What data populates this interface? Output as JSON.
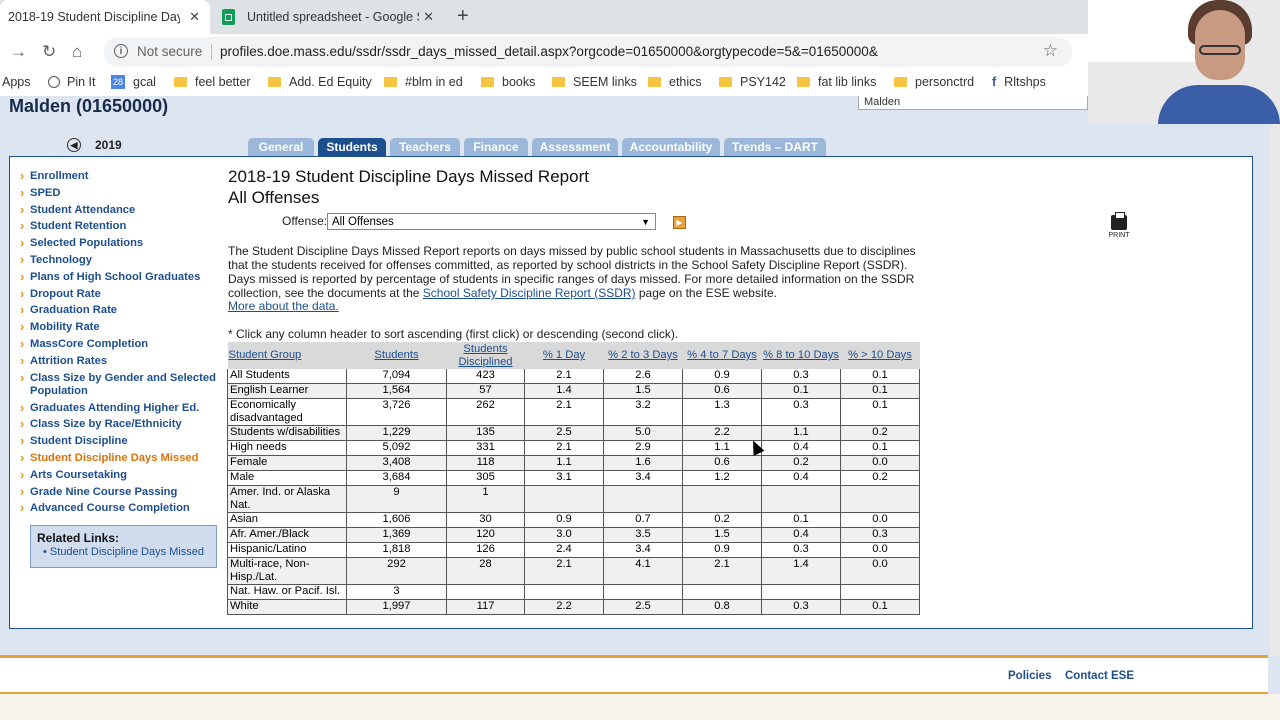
{
  "browser": {
    "tabs": [
      {
        "label": "2018-19 Student Discipline Days"
      },
      {
        "label": "Untitled spreadsheet - Google Sh"
      }
    ],
    "security": "Not secure",
    "url": "profiles.doe.mass.edu/ssdr/ssdr_days_missed_detail.aspx?orgcode=01650000&orgtypecode=5&=01650000&",
    "bookmarks": [
      "Apps",
      "Pin It",
      "gcal",
      "feel better",
      "Add. Ed Equity",
      "#blm in ed",
      "books",
      "SEEM links",
      "ethics",
      "PSY142",
      "fat lib links",
      "personctrd",
      "Rltshps"
    ],
    "gcal_icon": "28"
  },
  "page": {
    "org_name": "Malden (01650000)",
    "org_select": "Malden",
    "year": "2019",
    "tabs": [
      "General",
      "Students",
      "Teachers",
      "Finance",
      "Assessment",
      "Accountability",
      "Trends – DART"
    ],
    "sidenav": [
      "Enrollment",
      "SPED",
      "Student Attendance",
      "Student Retention",
      "Selected Populations",
      "Technology",
      "Plans of High School Graduates",
      "Dropout Rate",
      "Graduation Rate",
      "Mobility Rate",
      "MassCore Completion",
      "Attrition Rates",
      "Class Size by Gender and Selected Population",
      "Graduates Attending Higher Ed.",
      "Class Size by Race/Ethnicity",
      "Student Discipline",
      "Student Discipline Days Missed",
      "Arts Coursetaking",
      "Grade Nine Course Passing",
      "Advanced Course Completion"
    ],
    "related_heading": "Related Links:",
    "related_link": "Student Discipline Days Missed",
    "title_line1": "2018-19 Student Discipline Days Missed Report",
    "title_line2": "All Offenses",
    "offense_label": "Offense:",
    "offense_value": "All Offenses",
    "desc_part1": "The Student Discipline Days Missed Report reports on days missed by public school students in Massachusetts due to disciplines that the students received for offenses committed, as reported by school districts in the School Safety Discipline Report (SSDR). Days missed is reported by percentage of students in specific ranges of days missed. For more detailed information on the SSDR collection, see the documents at the ",
    "desc_link": "School Safety Discipline Report (SSDR)",
    "desc_part2": " page on the ESE website.",
    "more_link": "More about the data.",
    "sort_note": "* Click any column header to sort ascending (first click) or descending (second click).",
    "print_label": "PRINT",
    "footer_policies": "Policies",
    "footer_contact": "Contact ESE"
  },
  "table": {
    "headers": [
      "Student Group",
      "Students",
      "Students Disciplined",
      "% 1 Day",
      "% 2 to 3 Days",
      "% 4 to 7 Days",
      "% 8 to 10 Days",
      "% > 10 Days"
    ],
    "rows": [
      [
        "All Students",
        "7,094",
        "423",
        "2.1",
        "2.6",
        "0.9",
        "0.3",
        "0.1"
      ],
      [
        "English Learner",
        "1,564",
        "57",
        "1.4",
        "1.5",
        "0.6",
        "0.1",
        "0.1"
      ],
      [
        "Economically disadvantaged",
        "3,726",
        "262",
        "2.1",
        "3.2",
        "1.3",
        "0.3",
        "0.1"
      ],
      [
        "Students w/disabilities",
        "1,229",
        "135",
        "2.5",
        "5.0",
        "2.2",
        "1.1",
        "0.2"
      ],
      [
        "High needs",
        "5,092",
        "331",
        "2.1",
        "2.9",
        "1.1",
        "0.4",
        "0.1"
      ],
      [
        "Female",
        "3,408",
        "118",
        "1.1",
        "1.6",
        "0.6",
        "0.2",
        "0.0"
      ],
      [
        "Male",
        "3,684",
        "305",
        "3.1",
        "3.4",
        "1.2",
        "0.4",
        "0.2"
      ],
      [
        "Amer. Ind. or Alaska Nat.",
        "9",
        "1",
        "",
        "",
        "",
        "",
        ""
      ],
      [
        "Asian",
        "1,606",
        "30",
        "0.9",
        "0.7",
        "0.2",
        "0.1",
        "0.0"
      ],
      [
        "Afr. Amer./Black",
        "1,369",
        "120",
        "3.0",
        "3.5",
        "1.5",
        "0.4",
        "0.3"
      ],
      [
        "Hispanic/Latino",
        "1,818",
        "126",
        "2.4",
        "3.4",
        "0.9",
        "0.3",
        "0.0"
      ],
      [
        "Multi-race, Non-Hisp./Lat.",
        "292",
        "28",
        "2.1",
        "4.1",
        "2.1",
        "1.4",
        "0.0"
      ],
      [
        "Nat. Haw. or Pacif. Isl.",
        "3",
        "",
        "",
        "",
        "",
        "",
        ""
      ],
      [
        "White",
        "1,997",
        "117",
        "2.2",
        "2.5",
        "0.8",
        "0.3",
        "0.1"
      ]
    ]
  }
}
